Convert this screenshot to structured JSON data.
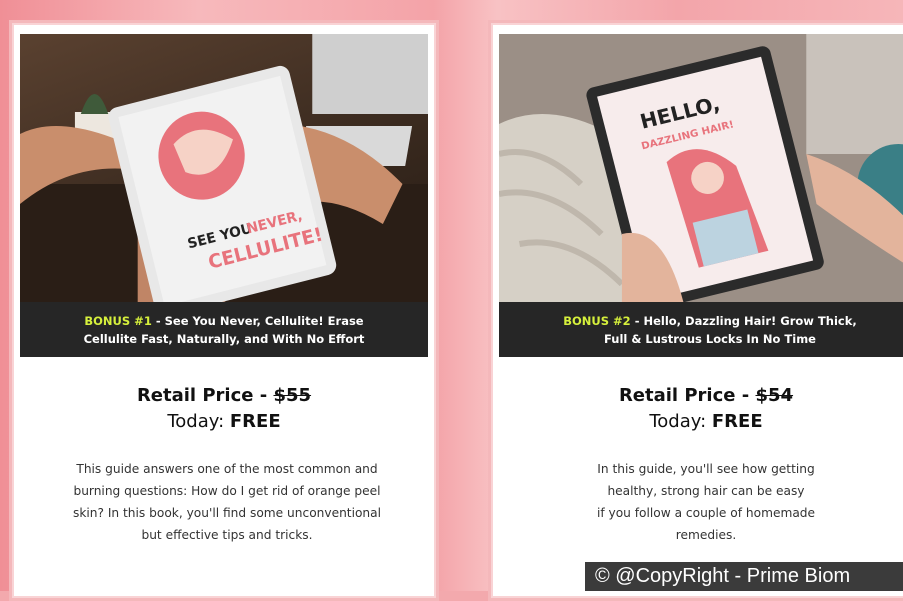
{
  "colors": {
    "page_background": "#f3a9ad",
    "banner_background": "#262626",
    "bonus_highlight": "#d6f03c",
    "tablet_accent": "#e8737c"
  },
  "cards": [
    {
      "image": {
        "tablet_line1": "SEE YOU",
        "tablet_line1_accent": "NEVER,",
        "tablet_line2": "CELLULITE!"
      },
      "bonus_tag": "BONUS #1",
      "bonus_line1": " - See You Never, Cellulite! Erase",
      "bonus_line2": "Cellulite Fast, Naturally, and With No Effort",
      "retail_label": "Retail Price - ",
      "retail_price": "$55",
      "today_label": "Today: ",
      "today_value": "FREE",
      "description_lines": [
        "This guide answers one of the most common and",
        "burning questions: How do I get rid of orange peel",
        "skin? In this book, you'll find some unconventional",
        "but effective tips and tricks."
      ]
    },
    {
      "image": {
        "tablet_line1": "HELLO,",
        "tablet_line2": "DAZZLING HAIR!"
      },
      "bonus_tag": "BONUS #2",
      "bonus_line1": " - Hello, Dazzling Hair! Grow Thick,",
      "bonus_line2": "Full & Lustrous Locks In No Time",
      "retail_label": "Retail Price - ",
      "retail_price": "$54",
      "today_label": "Today: ",
      "today_value": "FREE",
      "description_lines": [
        "In this guide, you'll see how getting",
        "healthy, strong hair can be easy",
        "if you follow a couple of homemade",
        "remedies."
      ]
    }
  ],
  "watermark": "© @CopyRight - Prime Biom"
}
